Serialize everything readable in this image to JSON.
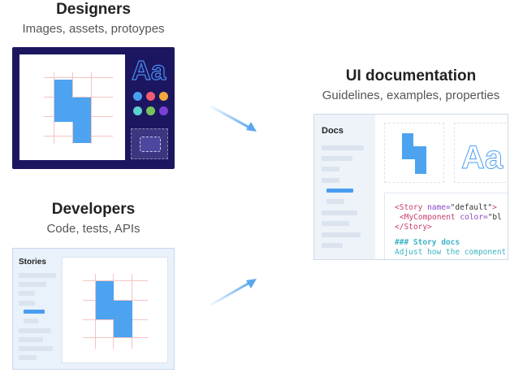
{
  "designers": {
    "title": "Designers",
    "subtitle": "Images, assets, protoypes",
    "aa_text": "Aa",
    "swatches": [
      "#4a9ef0",
      "#ef5d73",
      "#f4a93b",
      "#5ecfd0",
      "#77c35b",
      "#7a3fd6"
    ]
  },
  "developers": {
    "title": "Developers",
    "subtitle": "Code, tests, APIs",
    "sidebar_title": "Stories"
  },
  "docs": {
    "title": "UI documentation",
    "subtitle": "Guidelines, examples, properties",
    "sidebar_title": "Docs",
    "aa_text": "Aa",
    "code": {
      "open_tag": "<Story",
      "name_attr": "name=",
      "name_value": "\"default\"",
      "open_close": ">",
      "component": "<MyComponent",
      "color_attr": "color=",
      "color_value": "\"bl",
      "close_tag": "</Story>",
      "heading": "### Story docs",
      "body": "Adjust how the component"
    }
  },
  "colors": {
    "accent_blue": "#4da3ef",
    "designer_bg": "#1c1660",
    "arrow": "#5aa7ef",
    "grid_pink": "#f3c4c4"
  }
}
